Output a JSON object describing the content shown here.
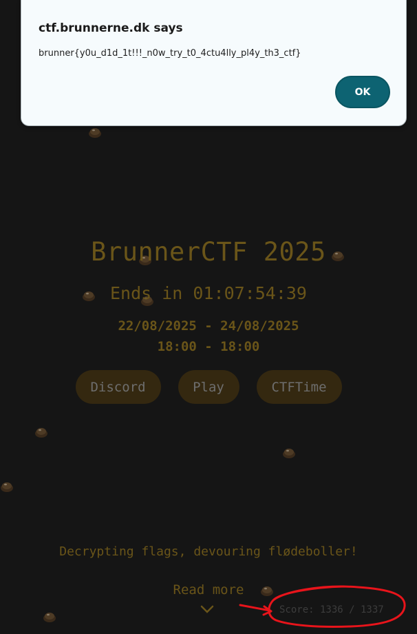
{
  "dialog": {
    "title": "ctf.brunnerne.dk says",
    "message": "brunner{y0u_d1d_1t!!!_n0w_try_t0_4ctu4lly_pl4y_th3_ctf}",
    "ok_label": "OK"
  },
  "page": {
    "title": "BrunnerCTF 2025",
    "countdown": "Ends in 01:07:54:39",
    "date_range": "22/08/2025 - 24/08/2025",
    "time_range": "18:00 - 18:00",
    "buttons": {
      "discord": "Discord",
      "play": "Play",
      "ctftime": "CTFTime"
    },
    "tagline": "Decrypting flags, devouring flødeboller!",
    "read_more": "Read more",
    "score": "Score: 1336 / 1337"
  },
  "colors": {
    "accent_text": "#6a5519",
    "pill_bg": "#342810",
    "dialog_button": "#0d6372",
    "annotation": "#e8141b"
  },
  "icons": {
    "cookie": "flodebolle-icon",
    "chevron": "chevron-down-icon"
  }
}
